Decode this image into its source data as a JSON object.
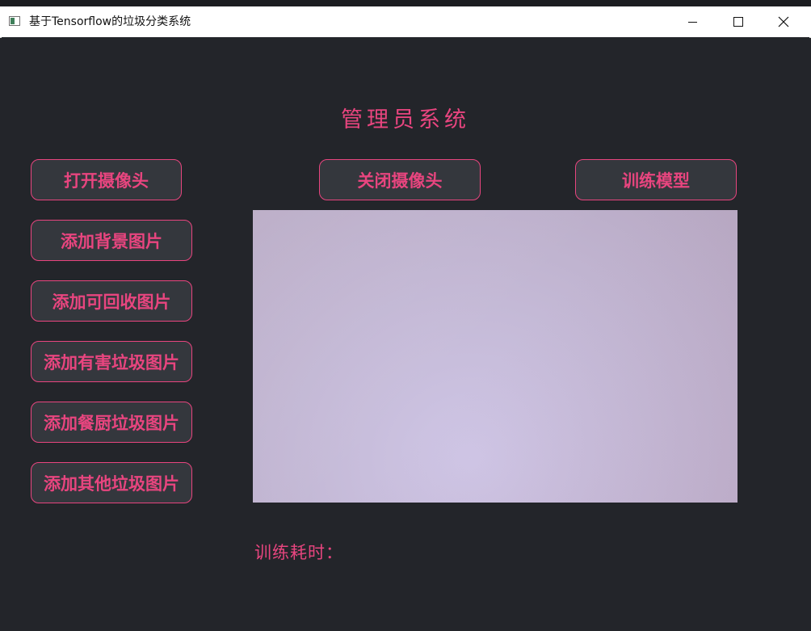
{
  "window": {
    "title": "基于Tensorflow的垃圾分类系统"
  },
  "controls": {
    "minimize_icon": "minimize-icon",
    "maximize_icon": "maximize-icon",
    "close_icon": "close-icon"
  },
  "page": {
    "title": "管理员系统"
  },
  "buttons": {
    "open_camera": "打开摄像头",
    "close_camera": "关闭摄像头",
    "train_model": "训练模型",
    "add_background": "添加背景图片",
    "add_recyclable": "添加可回收图片",
    "add_hazardous": "添加有害垃圾图片",
    "add_kitchen": "添加餐厨垃圾图片",
    "add_other": "添加其他垃圾图片"
  },
  "status": {
    "training_time_label": "训练耗时："
  },
  "colors": {
    "accent": "#e8457f",
    "background": "#23252a",
    "button_bg": "#34373d"
  }
}
